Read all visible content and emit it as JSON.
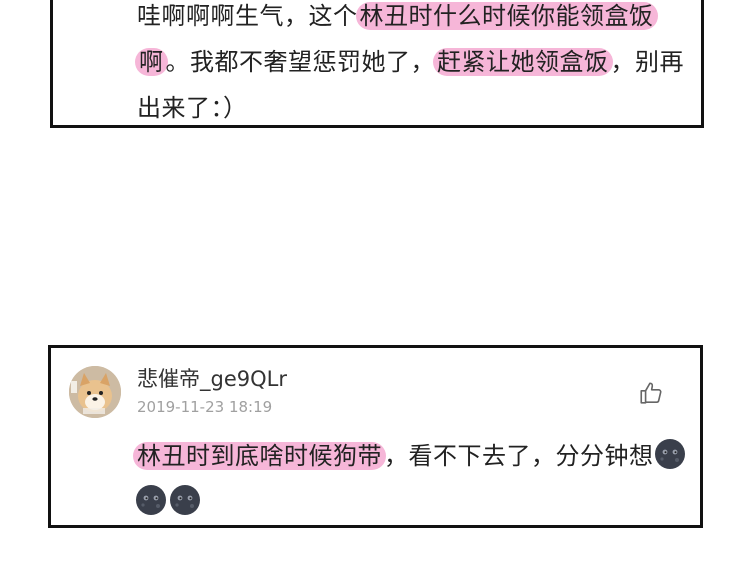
{
  "comment1": {
    "line1_normal": "哇啊啊啊生气，这个",
    "line1_highlight": "林丑时什么时候你能领盒饭啊",
    "line2_normal": "。我都不奢望惩罚她了，",
    "line2_highlight": "赶紧让她领盒饭",
    "line3_normal": "，别再出来了：）"
  },
  "comment2": {
    "username": "悲催帝_ge9QLr",
    "timestamp": "2019-11-23 18:19",
    "highlight": "林丑时到底啥时候狗带",
    "text": "，看不下去了，分分钟想",
    "emoji_icon": "new-moon-face-icon"
  },
  "colors": {
    "highlight": "#f6b6d8",
    "border": "#111111",
    "timestamp": "#a0a0a0"
  }
}
